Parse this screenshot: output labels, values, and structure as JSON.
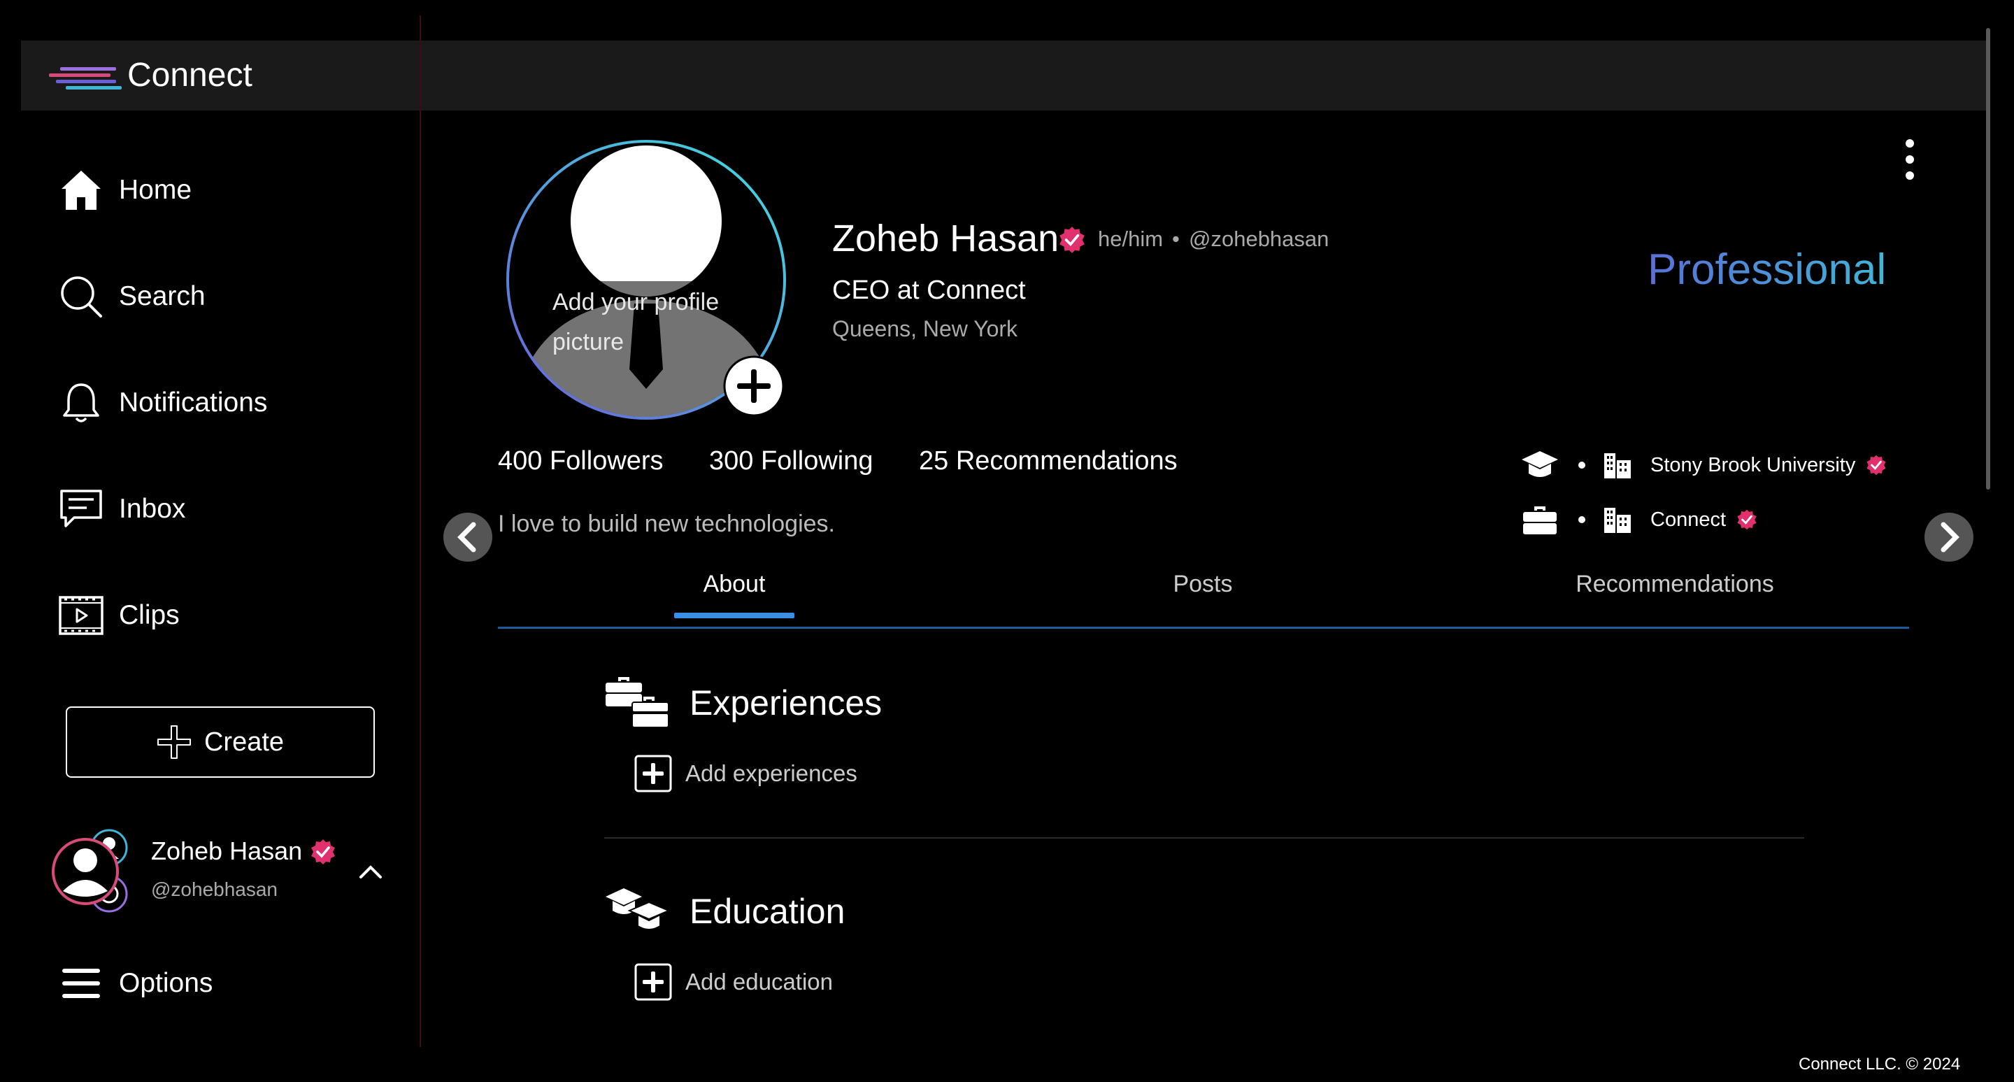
{
  "app": {
    "name": "Connect"
  },
  "sidebar": {
    "items": [
      {
        "label": "Home",
        "icon": "home-icon"
      },
      {
        "label": "Search",
        "icon": "search-icon"
      },
      {
        "label": "Notifications",
        "icon": "bell-icon"
      },
      {
        "label": "Inbox",
        "icon": "chat-icon"
      },
      {
        "label": "Clips",
        "icon": "film-icon"
      }
    ],
    "create_label": "Create",
    "account": {
      "name": "Zoheb Hasan",
      "handle": "@zohebhasan"
    },
    "options_label": "Options"
  },
  "profile": {
    "avatar_prompt": "Add your profile picture",
    "name": "Zoheb Hasan",
    "pronouns": "he/him",
    "separator": "•",
    "handle": "@zohebhasan",
    "headline": "CEO at Connect",
    "location": "Queens, New York",
    "badge": "Professional",
    "stats": {
      "followers": "400 Followers",
      "following": "300 Following",
      "recommendations": "25 Recommendations"
    },
    "bio": "I love to build new technologies.",
    "affiliations": [
      {
        "type": "education",
        "name": "Stony Brook University"
      },
      {
        "type": "work",
        "name": "Connect"
      }
    ]
  },
  "tabs": [
    {
      "label": "About",
      "active": true
    },
    {
      "label": "Posts"
    },
    {
      "label": "Recommendations"
    }
  ],
  "about": {
    "experiences": {
      "title": "Experiences",
      "add_label": "Add experiences"
    },
    "education": {
      "title": "Education",
      "add_label": "Add education"
    }
  },
  "footer": {
    "text": "Connect LLC. © 2024"
  },
  "colors": {
    "verified": "#e0306e",
    "accent_blue": "#3b8ee5",
    "professional_gradient": [
      "#5a6fd8",
      "#3fb6d8"
    ]
  }
}
